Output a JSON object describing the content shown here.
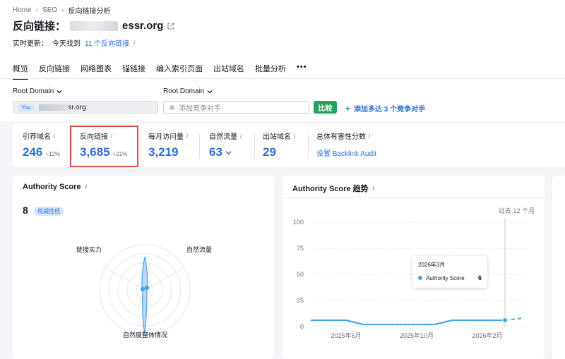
{
  "breadcrumb": {
    "items": [
      "Home",
      "SEO",
      "反向链接分析"
    ]
  },
  "header": {
    "title": "反向链接：",
    "domain_suffix": "essr.org",
    "update_prefix": "实时更新：",
    "update_today": "今天找到",
    "update_link": "11 个反向链接"
  },
  "tabs": [
    "概览",
    "反向链接",
    "网络图表",
    "锚链接",
    "编入索引页面",
    "出站域名",
    "批量分析"
  ],
  "filters": {
    "root_domain_label": "Root Domain",
    "you_badge": "You",
    "you_domain": "sr.org",
    "competitor_placeholder": "添加竞争对手",
    "compare_label": "比较",
    "add_competitors": "添加多达 3 个竞争对手"
  },
  "metrics": [
    {
      "label": "引荐域名",
      "value": "246",
      "delta": "+12%"
    },
    {
      "label": "反向链接",
      "value": "3,685",
      "delta": "+21%"
    },
    {
      "label": "每月访问量",
      "value": "3,219"
    },
    {
      "label": "自然流量",
      "value": "63"
    },
    {
      "label": "出站域名",
      "value": "29"
    },
    {
      "label": "总体有害性分数",
      "link": "设置 Backlink Audit"
    }
  ],
  "authority_card": {
    "title": "Authority Score",
    "score": "8",
    "badge": "权威性低",
    "radar_labels": [
      "链接实力",
      "自然流量",
      "自然度整体情况"
    ]
  },
  "trend_card": {
    "title": "Authority Score 趋势",
    "period": "过去 12 个月",
    "tooltip": {
      "date": "2026年3月",
      "series": "Authority Score",
      "value": "6"
    }
  },
  "chart_data": {
    "type": "line",
    "title": "Authority Score 趋势",
    "x_tick_labels": [
      "2025年6月",
      "2025年10月",
      "2026年2月"
    ],
    "y_ticks": [
      0,
      25,
      50,
      75,
      100
    ],
    "ylim": [
      0,
      100
    ],
    "x": [
      "2025年4月",
      "2025年5月",
      "2025年6月",
      "2025年7月",
      "2025年8月",
      "2025年9月",
      "2025年10月",
      "2025年11月",
      "2025年12月",
      "2026年1月",
      "2026年2月",
      "2026年3月",
      "2026年4月"
    ],
    "series": [
      {
        "values": [
          6,
          6,
          6,
          2,
          2,
          2,
          2,
          2,
          6,
          6,
          6,
          6,
          8
        ]
      }
    ],
    "grid": true,
    "color": "#4aa3e6"
  }
}
